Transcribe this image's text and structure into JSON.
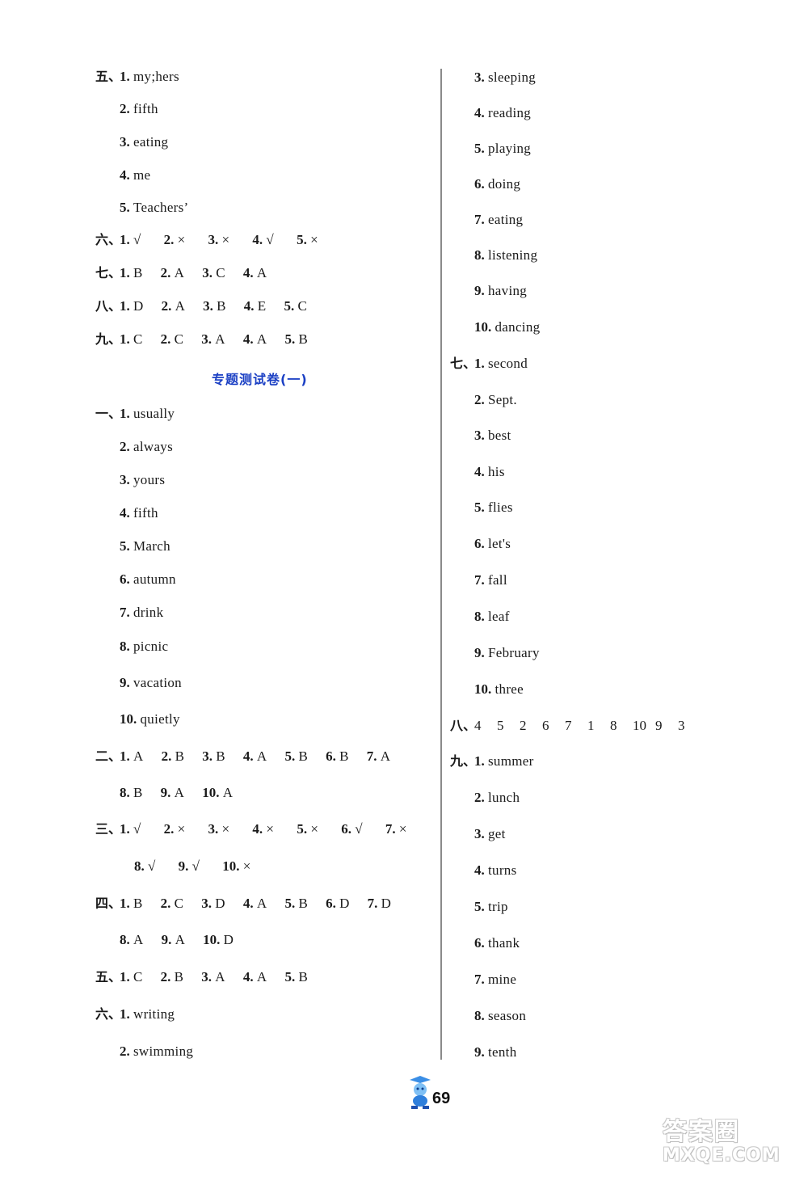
{
  "left": {
    "s5": {
      "sec": "五、",
      "items": [
        {
          "n": "1.",
          "a": "my;hers"
        },
        {
          "n": "2.",
          "a": "fifth"
        },
        {
          "n": "3.",
          "a": "eating"
        },
        {
          "n": "4.",
          "a": "me"
        },
        {
          "n": "5.",
          "a": "Teachers’"
        }
      ]
    },
    "s6": {
      "sec": "六、",
      "items": [
        {
          "n": "1.",
          "a": "√"
        },
        {
          "n": "2.",
          "a": "×"
        },
        {
          "n": "3.",
          "a": "×"
        },
        {
          "n": "4.",
          "a": "√"
        },
        {
          "n": "5.",
          "a": "×"
        }
      ]
    },
    "s7": {
      "sec": "七、",
      "items": [
        {
          "n": "1.",
          "a": "B"
        },
        {
          "n": "2.",
          "a": "A"
        },
        {
          "n": "3.",
          "a": "C"
        },
        {
          "n": "4.",
          "a": "A"
        }
      ]
    },
    "s8": {
      "sec": "八、",
      "items": [
        {
          "n": "1.",
          "a": "D"
        },
        {
          "n": "2.",
          "a": "A"
        },
        {
          "n": "3.",
          "a": "B"
        },
        {
          "n": "4.",
          "a": "E"
        },
        {
          "n": "5.",
          "a": "C"
        }
      ]
    },
    "s9": {
      "sec": "九、",
      "items": [
        {
          "n": "1.",
          "a": "C"
        },
        {
          "n": "2.",
          "a": "C"
        },
        {
          "n": "3.",
          "a": "A"
        },
        {
          "n": "4.",
          "a": "A"
        },
        {
          "n": "5.",
          "a": "B"
        }
      ]
    },
    "heading": "专题测试卷(一)",
    "t1": {
      "sec": "一、",
      "items": [
        {
          "n": "1.",
          "a": "usually"
        },
        {
          "n": "2.",
          "a": "always"
        },
        {
          "n": "3.",
          "a": "yours"
        },
        {
          "n": "4.",
          "a": "fifth"
        },
        {
          "n": "5.",
          "a": "March"
        },
        {
          "n": "6.",
          "a": "autumn"
        },
        {
          "n": "7.",
          "a": "drink"
        },
        {
          "n": "8.",
          "a": "picnic"
        },
        {
          "n": "9.",
          "a": "vacation"
        },
        {
          "n": "10.",
          "a": "quietly"
        }
      ]
    },
    "t2": {
      "sec": "二、",
      "items": [
        {
          "n": "1.",
          "a": "A"
        },
        {
          "n": "2.",
          "a": "B"
        },
        {
          "n": "3.",
          "a": "B"
        },
        {
          "n": "4.",
          "a": "A"
        },
        {
          "n": "5.",
          "a": "B"
        },
        {
          "n": "6.",
          "a": "B"
        },
        {
          "n": "7.",
          "a": "A"
        },
        {
          "n": "8.",
          "a": "B"
        },
        {
          "n": "9.",
          "a": "A"
        },
        {
          "n": "10.",
          "a": "A"
        }
      ]
    },
    "t3": {
      "sec": "三、",
      "items": [
        {
          "n": "1.",
          "a": "√"
        },
        {
          "n": "2.",
          "a": "×"
        },
        {
          "n": "3.",
          "a": "×"
        },
        {
          "n": "4.",
          "a": "×"
        },
        {
          "n": "5.",
          "a": "×"
        },
        {
          "n": "6.",
          "a": "√"
        },
        {
          "n": "7.",
          "a": "×"
        },
        {
          "n": "8.",
          "a": "√"
        },
        {
          "n": "9.",
          "a": "√"
        },
        {
          "n": "10.",
          "a": "×"
        }
      ]
    },
    "t4": {
      "sec": "四、",
      "items": [
        {
          "n": "1.",
          "a": "B"
        },
        {
          "n": "2.",
          "a": "C"
        },
        {
          "n": "3.",
          "a": "D"
        },
        {
          "n": "4.",
          "a": "A"
        },
        {
          "n": "5.",
          "a": "B"
        },
        {
          "n": "6.",
          "a": "D"
        },
        {
          "n": "7.",
          "a": "D"
        },
        {
          "n": "8.",
          "a": "A"
        },
        {
          "n": "9.",
          "a": "A"
        },
        {
          "n": "10.",
          "a": "D"
        }
      ]
    },
    "t5": {
      "sec": "五、",
      "items": [
        {
          "n": "1.",
          "a": "C"
        },
        {
          "n": "2.",
          "a": "B"
        },
        {
          "n": "3.",
          "a": "A"
        },
        {
          "n": "4.",
          "a": "A"
        },
        {
          "n": "5.",
          "a": "B"
        }
      ]
    },
    "t6": {
      "sec": "六、",
      "items": [
        {
          "n": "1.",
          "a": "writing"
        },
        {
          "n": "2.",
          "a": "swimming"
        }
      ]
    }
  },
  "right": {
    "t6cont": {
      "items": [
        {
          "n": "3.",
          "a": "sleeping"
        },
        {
          "n": "4.",
          "a": "reading"
        },
        {
          "n": "5.",
          "a": "playing"
        },
        {
          "n": "6.",
          "a": "doing"
        },
        {
          "n": "7.",
          "a": "eating"
        },
        {
          "n": "8.",
          "a": "listening"
        },
        {
          "n": "9.",
          "a": "having"
        },
        {
          "n": "10.",
          "a": "dancing"
        }
      ]
    },
    "t7": {
      "sec": "七、",
      "items": [
        {
          "n": "1.",
          "a": "second"
        },
        {
          "n": "2.",
          "a": "Sept."
        },
        {
          "n": "3.",
          "a": "best"
        },
        {
          "n": "4.",
          "a": "his"
        },
        {
          "n": "5.",
          "a": "flies"
        },
        {
          "n": "6.",
          "a": "let's"
        },
        {
          "n": "7.",
          "a": "fall"
        },
        {
          "n": "8.",
          "a": "leaf"
        },
        {
          "n": "9.",
          "a": "February"
        },
        {
          "n": "10.",
          "a": "three"
        }
      ]
    },
    "t8": {
      "sec": "八、",
      "order": [
        "4",
        "5",
        "2",
        "6",
        "7",
        "1",
        "8",
        "10",
        "9",
        "3"
      ]
    },
    "t9": {
      "sec": "九、",
      "items": [
        {
          "n": "1.",
          "a": "summer"
        },
        {
          "n": "2.",
          "a": "lunch"
        },
        {
          "n": "3.",
          "a": "get"
        },
        {
          "n": "4.",
          "a": "turns"
        },
        {
          "n": "5.",
          "a": "trip"
        },
        {
          "n": "6.",
          "a": "thank"
        },
        {
          "n": "7.",
          "a": "mine"
        },
        {
          "n": "8.",
          "a": "season"
        },
        {
          "n": "9.",
          "a": "tenth"
        }
      ]
    }
  },
  "footer": {
    "page_number": "69",
    "mascot_icon": "cartoon-mascot-icon"
  },
  "watermark": {
    "cn": "答案圈",
    "en": "MXQE.COM"
  }
}
